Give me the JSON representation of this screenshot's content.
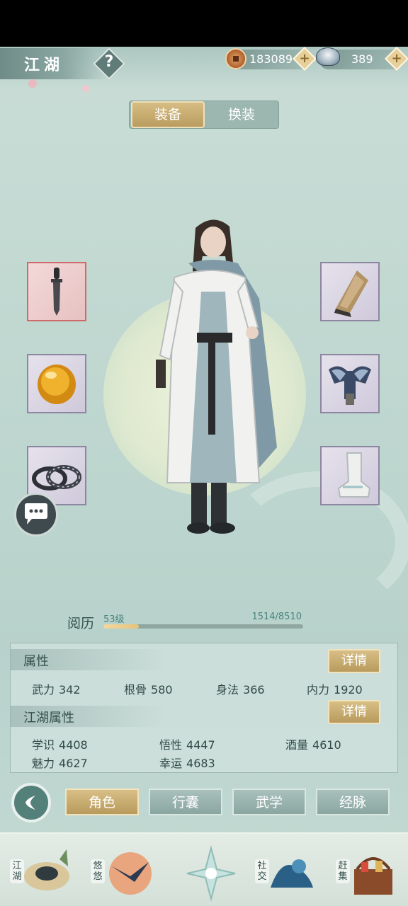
{
  "header": {
    "title": "江湖",
    "help_label": "?",
    "copper": "183089",
    "silver": "389",
    "plus_label": "+"
  },
  "tabs": {
    "equip": "装备",
    "outfit": "换装"
  },
  "experience": {
    "label": "阅历",
    "level": "53级",
    "progress_text": "1514/8510",
    "current": 1514,
    "max": 8510
  },
  "attributes": {
    "title": "属性",
    "detail_label": "详情",
    "items": [
      {
        "name": "武力",
        "value": "342"
      },
      {
        "name": "根骨",
        "value": "580"
      },
      {
        "name": "身法",
        "value": "366"
      },
      {
        "name": "内力",
        "value": "1920"
      }
    ]
  },
  "jianghu_attributes": {
    "title": "江湖属性",
    "detail_label": "详情",
    "items": [
      {
        "name": "学识",
        "value": "4408"
      },
      {
        "name": "悟性",
        "value": "4447"
      },
      {
        "name": "酒量",
        "value": "4610"
      },
      {
        "name": "魅力",
        "value": "4627"
      },
      {
        "name": "幸运",
        "value": "4683"
      }
    ]
  },
  "bottom_tabs": [
    "角色",
    "行囊",
    "武学",
    "经脉"
  ],
  "nav": [
    "江湖",
    "悠悠",
    "社交",
    "赶集"
  ],
  "colors": {
    "accent_gold": "#b89a5c",
    "bg_teal": "#bfd7d0",
    "text_dark": "#2f4a46"
  },
  "icons": {
    "slots": [
      "dagger-icon",
      "amber-gem-icon",
      "bracelet-icon",
      "bracer-icon",
      "armor-icon",
      "boot-icon"
    ],
    "chat": "chat-bubble-icon",
    "back": "back-arrow-icon"
  }
}
